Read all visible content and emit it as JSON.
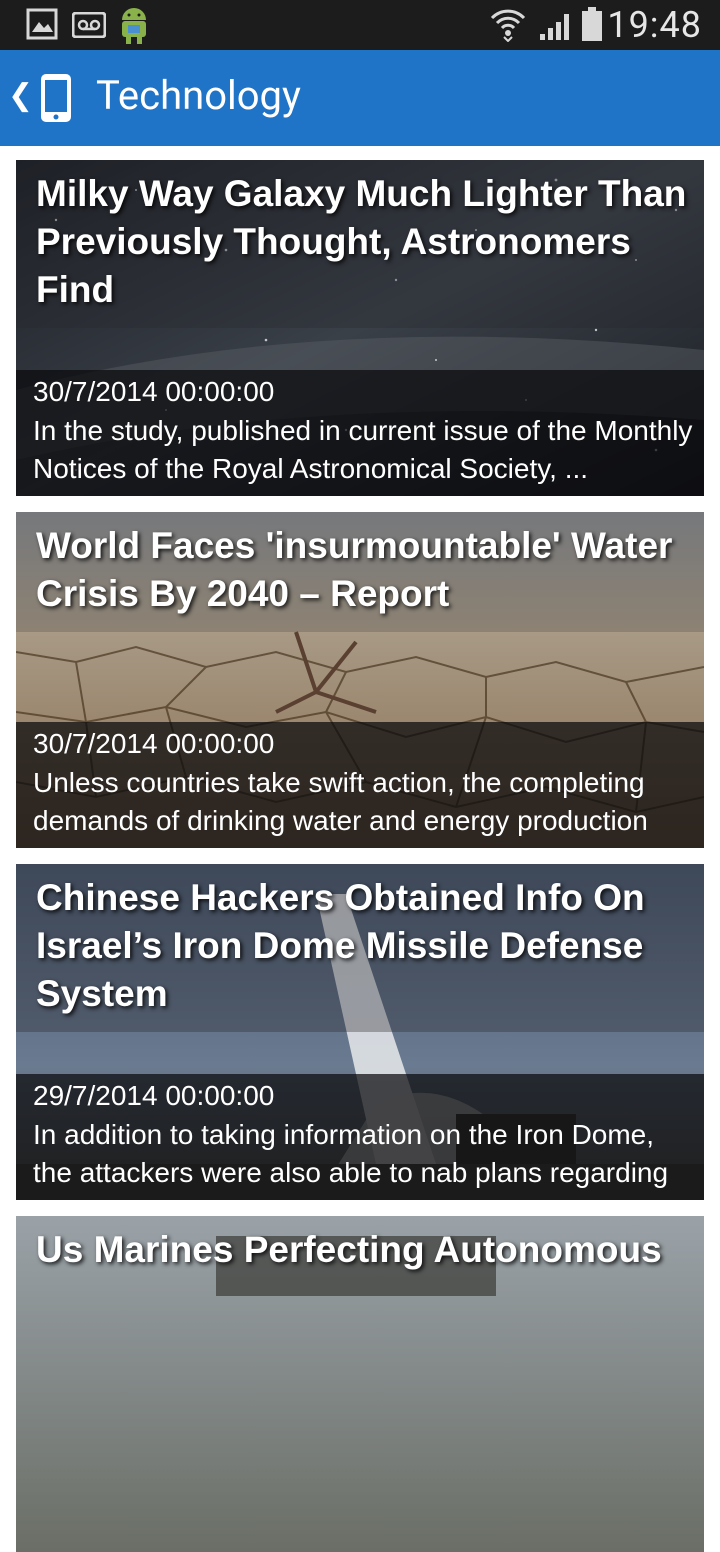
{
  "status_bar": {
    "time": "19:48"
  },
  "action_bar": {
    "title": "Technology"
  },
  "articles": [
    {
      "headline": "Milky Way Galaxy Much Lighter Than Previously Thought, Astronomers Find",
      "date": "30/7/2014 00:00:00",
      "summary": "In the study, published in current issue of the Monthly Notices of the Royal Astronomical Society, ..."
    },
    {
      "headline": "World Faces 'insurmountable' Water Crisis By 2040 – Report",
      "date": "30/7/2014 00:00:00",
      "summary": "Unless countries take swift action, the completing demands of drinking water and energy production will ..."
    },
    {
      "headline": "Chinese Hackers Obtained Info On Israel’s Iron Dome Missile Defense System",
      "date": "29/7/2014 00:00:00",
      "summary": "In addition to taking information on the Iron Dome, the attackers were also able to nab plans regarding other rockets and missile systems ..."
    },
    {
      "headline": "Us Marines Perfecting Autonomous",
      "date": "",
      "summary": ""
    }
  ],
  "colors": {
    "status_bar": "#1c1c1c",
    "action_bar": "#1f74c7"
  }
}
